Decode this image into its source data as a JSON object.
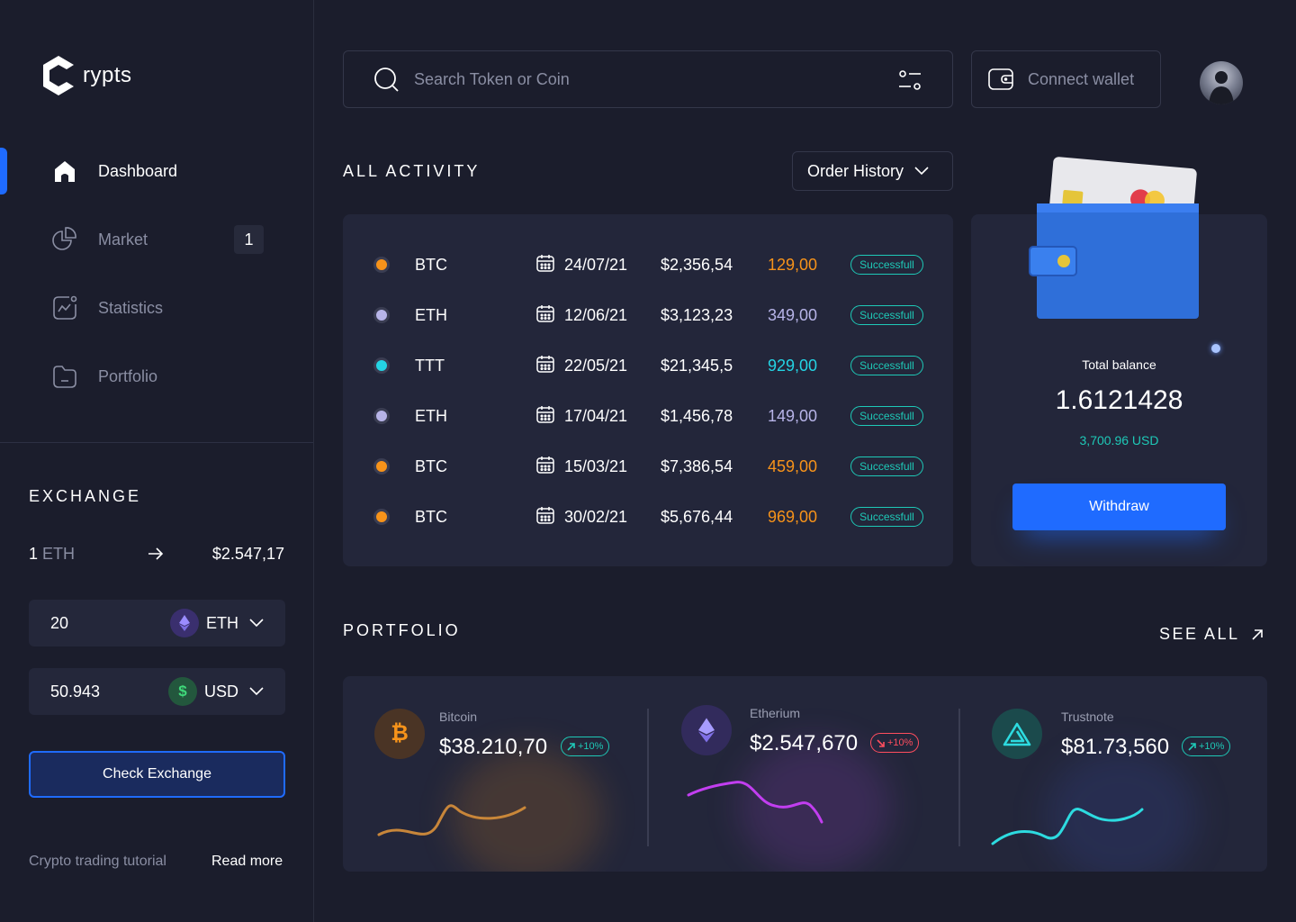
{
  "brand": {
    "name": "rypts"
  },
  "sidebar": {
    "items": [
      {
        "label": "Dashboard",
        "icon": "home-icon",
        "active": true
      },
      {
        "label": "Market",
        "icon": "pie-chart-icon",
        "badge": "1"
      },
      {
        "label": "Statistics",
        "icon": "statistics-icon"
      },
      {
        "label": "Portfolio",
        "icon": "folder-icon"
      }
    ]
  },
  "exchange": {
    "title": "EXCHANGE",
    "rate": {
      "amount": "1",
      "coin": "ETH",
      "value": "$2.547,17"
    },
    "from": {
      "value": "20",
      "currency": "ETH"
    },
    "to": {
      "value": "50.943",
      "currency": "USD"
    },
    "button": "Check Exchange",
    "tutorial": "Crypto trading tutorial",
    "read_more": "Read more"
  },
  "header": {
    "search_placeholder": "Search Token or Coin",
    "connect_wallet": "Connect wallet"
  },
  "activity": {
    "title": "ALL ACTIVITY",
    "filter": "Order History",
    "rows": [
      {
        "coin": "BTC",
        "date": "24/07/21",
        "amount": "$2,356,54",
        "qty": "129,00",
        "status": "Successfull",
        "color": "#f7931a"
      },
      {
        "coin": "ETH",
        "date": "12/06/21",
        "amount": "$3,123,23",
        "qty": "349,00",
        "status": "Successfull",
        "color": "#b7b4e8"
      },
      {
        "coin": "TTT",
        "date": "22/05/21",
        "amount": "$21,345,5",
        "qty": "929,00",
        "status": "Successfull",
        "color": "#24d4e4"
      },
      {
        "coin": "ETH",
        "date": "17/04/21",
        "amount": "$1,456,78",
        "qty": "149,00",
        "status": "Successfull",
        "color": "#b7b4e8"
      },
      {
        "coin": "BTC",
        "date": "15/03/21",
        "amount": "$7,386,54",
        "qty": "459,00",
        "status": "Successfull",
        "color": "#f7931a"
      },
      {
        "coin": "BTC",
        "date": "30/02/21",
        "amount": "$5,676,44",
        "qty": "969,00",
        "status": "Successfull",
        "color": "#f7931a"
      }
    ]
  },
  "balance": {
    "label": "Total balance",
    "value": "1.6121428",
    "usd": "3,700.96 USD",
    "withdraw": "Withdraw"
  },
  "portfolio": {
    "title": "PORTFOLIO",
    "see_all": "SEE ALL",
    "items": [
      {
        "name": "Bitcoin",
        "price": "$38.210,70",
        "change": "+10%",
        "direction": "up",
        "color": "#f7931a"
      },
      {
        "name": "Etherium",
        "price": "$2.547,670",
        "change": "+10%",
        "direction": "down",
        "color": "#9b8cff"
      },
      {
        "name": "Trustnote",
        "price": "$81.73,560",
        "change": "+10%",
        "direction": "up",
        "color": "#24d4e4"
      }
    ]
  },
  "colors": {
    "accent": "#1f6bff",
    "success": "#1ec9b7",
    "danger": "#ff4d5e",
    "background": "#1b1d2c",
    "card": "#23263a"
  }
}
